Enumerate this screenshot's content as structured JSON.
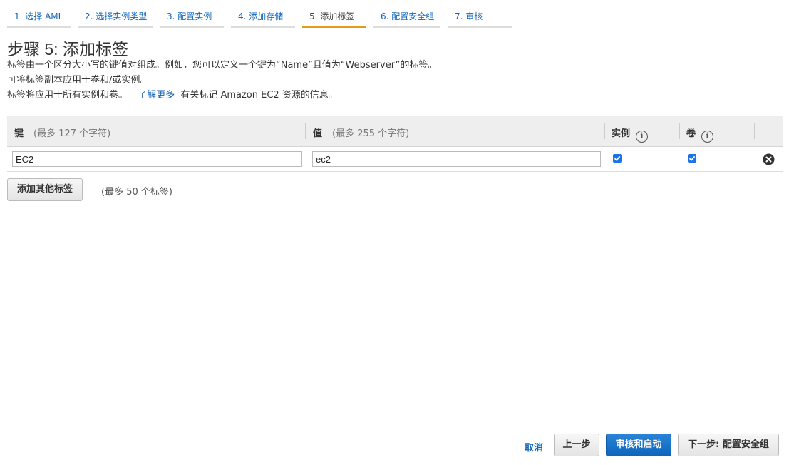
{
  "wizard": {
    "steps": [
      {
        "label": "1. 选择 AMI"
      },
      {
        "label": "2. 选择实例类型"
      },
      {
        "label": "3. 配置实例"
      },
      {
        "label": "4. 添加存储"
      },
      {
        "label": "5. 添加标签"
      },
      {
        "label": "6. 配置安全组"
      },
      {
        "label": "7. 审核"
      }
    ],
    "active_step": 4
  },
  "page": {
    "title": "步骤 5: 添加标签",
    "desc_line1": "标签由一个区分大小写的键值对组成。例如，您可以定义一个键为“Name”且值为“Webserver”的标签。",
    "desc_line2": "可将标签副本应用于卷和/或实例。",
    "desc_line3_prefix": "标签将应用于所有实例和卷。",
    "desc_line3_link": "了解更多",
    "desc_line3_suffix": "有关标记 Amazon EC2 资源的信息。"
  },
  "table": {
    "headers": {
      "key": "键",
      "key_hint": "(最多 127 个字符)",
      "value": "值",
      "value_hint": "(最多 255 个字符)",
      "instances": "实例",
      "volumes": "卷"
    },
    "rows": [
      {
        "key": "EC2",
        "value": "ec2",
        "instances": true,
        "volumes": true
      }
    ]
  },
  "actions": {
    "add_tag": "添加其他标签",
    "add_tag_hint": "(最多 50 个标签)",
    "cancel": "取消",
    "previous": "上一步",
    "review_launch": "审核和启动",
    "next": "下一步: 配置安全组"
  },
  "icons": {
    "info": "info-icon",
    "remove": "remove-circle-icon",
    "check": "checkbox-checked-icon"
  },
  "colors": {
    "link": "#1166bb",
    "active_step_underline": "#e59c1b",
    "primary_button": "#0e66bd",
    "checkbox": "#1a73e8"
  }
}
